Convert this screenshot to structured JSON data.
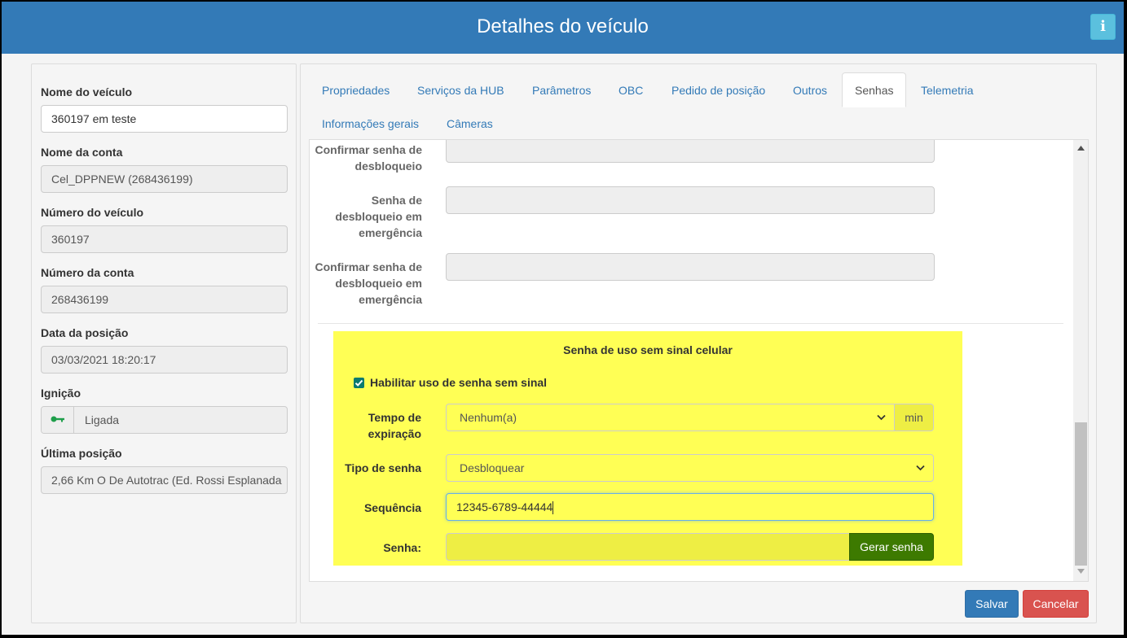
{
  "window": {
    "title": "Detalhes do veículo",
    "info_icon": "i"
  },
  "left": {
    "vehicle_name_label": "Nome do veículo",
    "vehicle_name_value": "360197 em teste",
    "account_name_label": "Nome da conta",
    "account_name_value": "Cel_DPPNEW (268436199)",
    "vehicle_number_label": "Número do veículo",
    "vehicle_number_value": "360197",
    "account_number_label": "Número da conta",
    "account_number_value": "268436199",
    "position_date_label": "Data da posição",
    "position_date_value": "03/03/2021 18:20:17",
    "ignition_label": "Ignição",
    "ignition_value": "Ligada",
    "ignition_icon": "key-icon",
    "last_position_label": "Última posição",
    "last_position_value": "2,66 Km O De Autotrac (Ed. Rossi Esplanada"
  },
  "tabs": [
    {
      "label": "Propriedades"
    },
    {
      "label": "Serviços da HUB"
    },
    {
      "label": "Parâmetros"
    },
    {
      "label": "OBC"
    },
    {
      "label": "Pedido de posição"
    },
    {
      "label": "Outros"
    },
    {
      "label": "Senhas",
      "active": true
    },
    {
      "label": "Telemetria"
    },
    {
      "label": "Informações gerais"
    },
    {
      "label": "Câmeras"
    }
  ],
  "senhas": {
    "confirm_unlock_label": "Confirmar senha de desbloqueio",
    "emergency_unlock_label": "Senha de desbloqueio em emergência",
    "confirm_emergency_label": "Confirmar senha de desbloqueio em emergência",
    "no_signal": {
      "title": "Senha de uso sem sinal celular",
      "enable_label": "Habilitar uso de senha sem sinal",
      "enable_checked": true,
      "expiration_label": "Tempo de expiração",
      "expiration_value": "Nenhum(a)",
      "expiration_unit": "min",
      "password_type_label": "Tipo de senha",
      "password_type_value": "Desbloquear",
      "sequence_label": "Sequência",
      "sequence_value": "12345-6789-44444",
      "password_label": "Senha:",
      "password_value": "",
      "generate_button": "Gerar senha"
    }
  },
  "footer": {
    "save_label": "Salvar",
    "cancel_label": "Cancelar"
  },
  "colors": {
    "titlebar": "#337ab7",
    "highlight": "#ffff55",
    "generate_button": "#3d7a00",
    "save_button": "#337ab7",
    "cancel_button": "#d9534f",
    "checkbox": "#0b7a6f",
    "key_icon": "#1e9e4a"
  }
}
